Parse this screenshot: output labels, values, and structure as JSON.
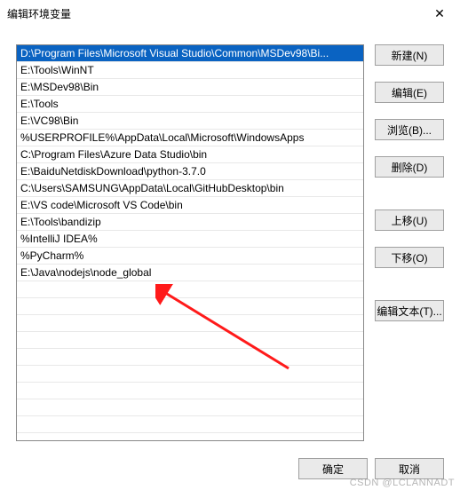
{
  "window": {
    "title": "编辑环境变量",
    "close_icon": "✕"
  },
  "list": {
    "items": [
      "D:\\Program Files\\Microsoft Visual Studio\\Common\\MSDev98\\Bi...",
      "E:\\Tools\\WinNT",
      "E:\\MSDev98\\Bin",
      "E:\\Tools",
      "E:\\VC98\\Bin",
      "%USERPROFILE%\\AppData\\Local\\Microsoft\\WindowsApps",
      "C:\\Program Files\\Azure Data Studio\\bin",
      "E:\\BaiduNetdiskDownload\\python-3.7.0",
      "C:\\Users\\SAMSUNG\\AppData\\Local\\GitHubDesktop\\bin",
      "E:\\VS code\\Microsoft VS Code\\bin",
      "E:\\Tools\\bandizip",
      "%IntelliJ IDEA%",
      "%PyCharm%",
      "E:\\Java\\nodejs\\node_global"
    ],
    "selected_index": 0
  },
  "buttons": {
    "new": "新建(N)",
    "edit": "编辑(E)",
    "browse": "浏览(B)...",
    "delete": "删除(D)",
    "move_up": "上移(U)",
    "move_down": "下移(O)",
    "edit_text": "编辑文本(T)...",
    "ok": "确定",
    "cancel": "取消"
  },
  "watermark": "CSDN @LCLANNADT"
}
